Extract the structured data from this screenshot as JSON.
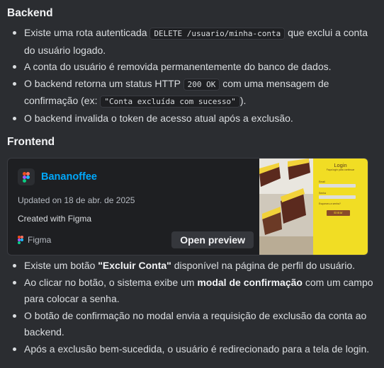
{
  "backend": {
    "heading": "Backend",
    "items": [
      {
        "pre": "Existe uma rota autenticada ",
        "code": "DELETE /usuario/minha-conta",
        "post": " que exclui a conta do usuário logado."
      },
      {
        "text": "A conta do usuário é removida permanentemente do banco de dados."
      },
      {
        "pre": "O backend retorna um status HTTP ",
        "code": "200 OK",
        "mid": " com uma mensagem de confirmação (ex: ",
        "code2": "\"Conta excluída com sucesso\"",
        "post": ")."
      },
      {
        "text": "O backend invalida o token de acesso atual após a exclusão."
      }
    ]
  },
  "frontend": {
    "heading": "Frontend",
    "embed": {
      "title": "Bananoffee",
      "updated": "Updated on 18 de abr. de 2025",
      "created": "Created with Figma",
      "provider": "Figma",
      "button": "Open preview",
      "thumb": {
        "login_title": "Login",
        "subtitle": "Faça login para continuar",
        "email_label": "Email",
        "password_label": "Senha",
        "forgot": "Esqueceu a senha?",
        "enter_button": "Entrar"
      }
    },
    "items": [
      {
        "pre": "Existe um botão ",
        "bold": "\"Excluir Conta\"",
        "post": " disponível na página de perfil do usuário."
      },
      {
        "pre": "Ao clicar no botão, o sistema exibe um ",
        "bold": "modal de confirmação",
        "post": " com um campo para colocar a senha."
      },
      {
        "text": "O botão de confirmação no modal envia a requisição de exclusão da conta ao backend."
      },
      {
        "text": "Após a exclusão bem-sucedida, o usuário é redirecionado para a tela de login."
      }
    ]
  }
}
